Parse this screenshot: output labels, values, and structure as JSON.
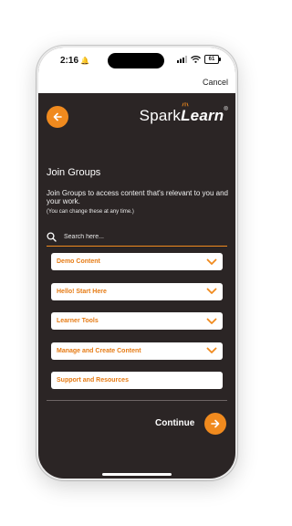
{
  "status_bar": {
    "time": "2:16",
    "battery": "61"
  },
  "header": {
    "cancel_label": "Cancel",
    "logo_spark": "Spark",
    "logo_learn": "Learn",
    "logo_mark": "®"
  },
  "content": {
    "title": "Join Groups",
    "description": "Join Groups to access content that's relevant to you and your work.",
    "note": "(You can change these at any time.)"
  },
  "search": {
    "placeholder": "Search here...",
    "value": ""
  },
  "groups": [
    {
      "label": "Demo Content",
      "expandable": true
    },
    {
      "label": "Hello! Start Here",
      "expandable": true
    },
    {
      "label": "Learner Tools",
      "expandable": true
    },
    {
      "label": "Manage and Create Content",
      "expandable": true
    },
    {
      "label": "Support and Resources",
      "expandable": false
    }
  ],
  "footer": {
    "continue_label": "Continue"
  },
  "colors": {
    "accent": "#f08a1e",
    "background": "#2b2525",
    "group_text": "#e67b14"
  },
  "icons": {
    "back": "arrow-left-icon",
    "continue": "arrow-right-icon",
    "search": "search-icon",
    "expand": "chevron-down-icon"
  }
}
